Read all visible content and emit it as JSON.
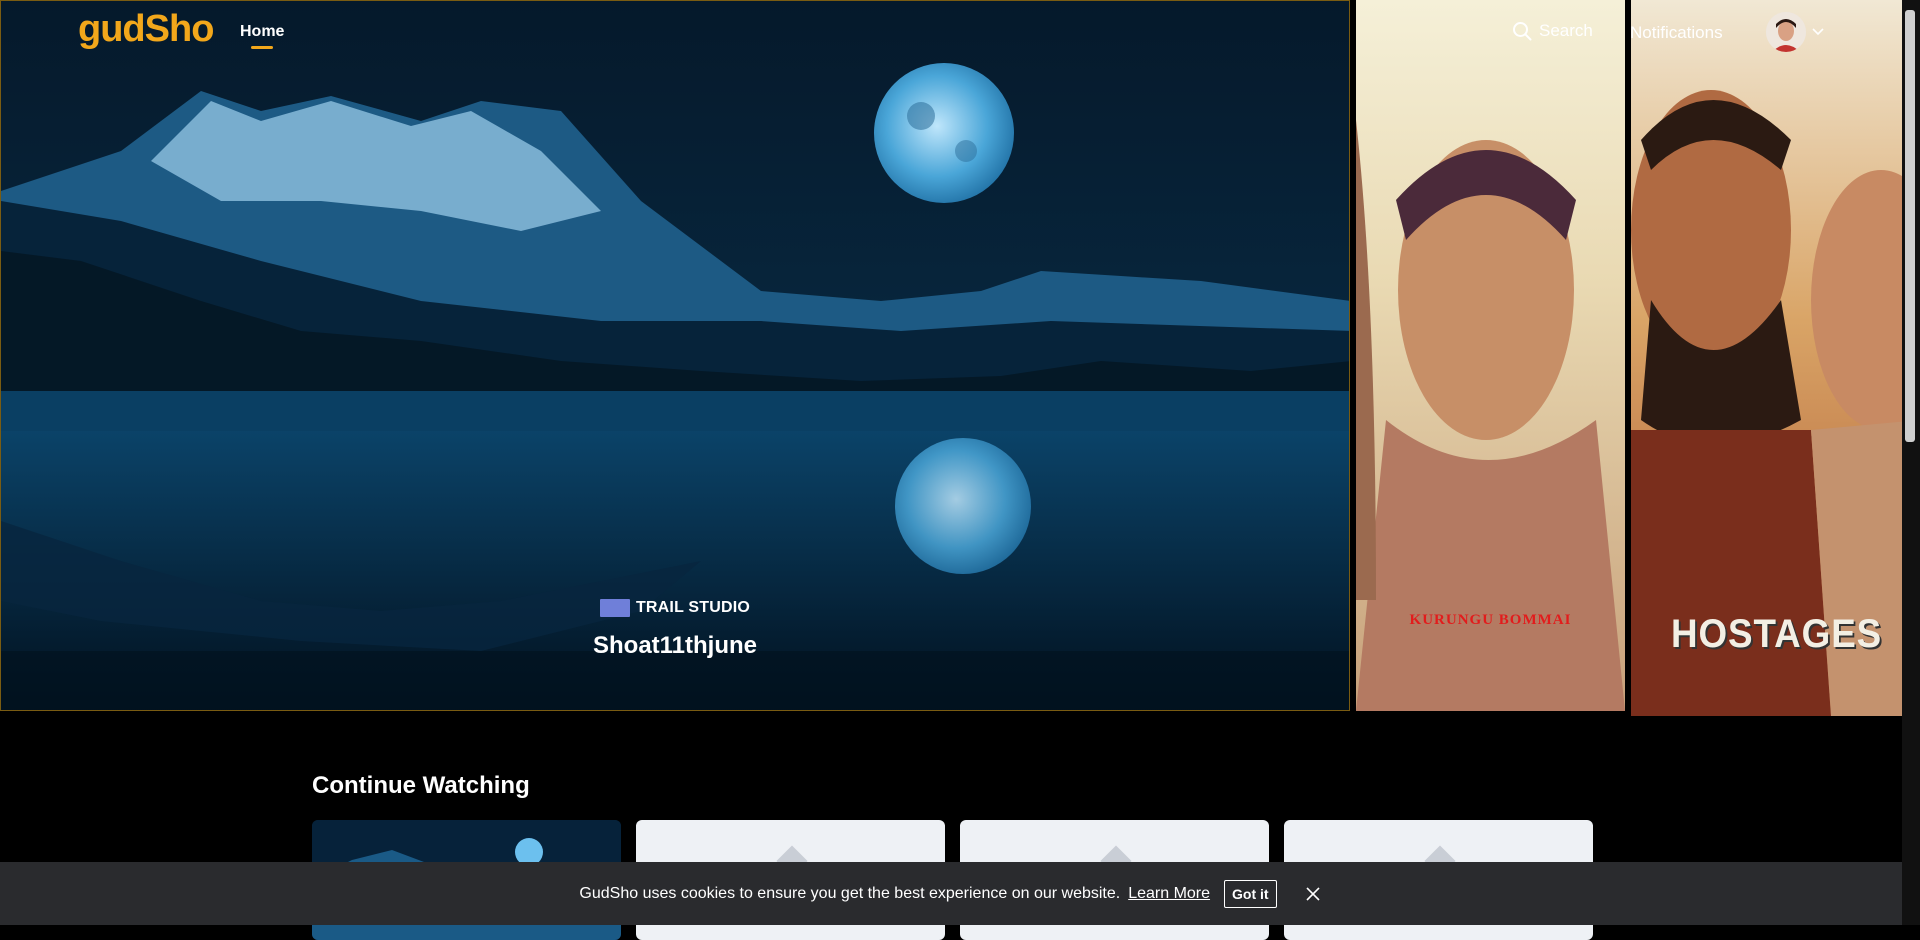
{
  "header": {
    "logo_text": "gudSho",
    "nav_home": "Home",
    "search_label": "Search",
    "notifications_label": "Notifications",
    "accent_color": "#f2a71b"
  },
  "hero": {
    "studio_name": "TRAIL STUDIO",
    "title": "Shoat11thjune",
    "side_posters": [
      {
        "title": "KURUNGU BOMMAI"
      },
      {
        "title": "HOSTAGES"
      }
    ]
  },
  "continue_watching": {
    "heading": "Continue Watching"
  },
  "cookie": {
    "message": "GudSho uses cookies to ensure you get the best experience on our website.",
    "learn_more": "Learn More",
    "accept": "Got it"
  },
  "icons": [
    "search-icon",
    "chevron-down-icon",
    "close-icon",
    "avatar"
  ]
}
